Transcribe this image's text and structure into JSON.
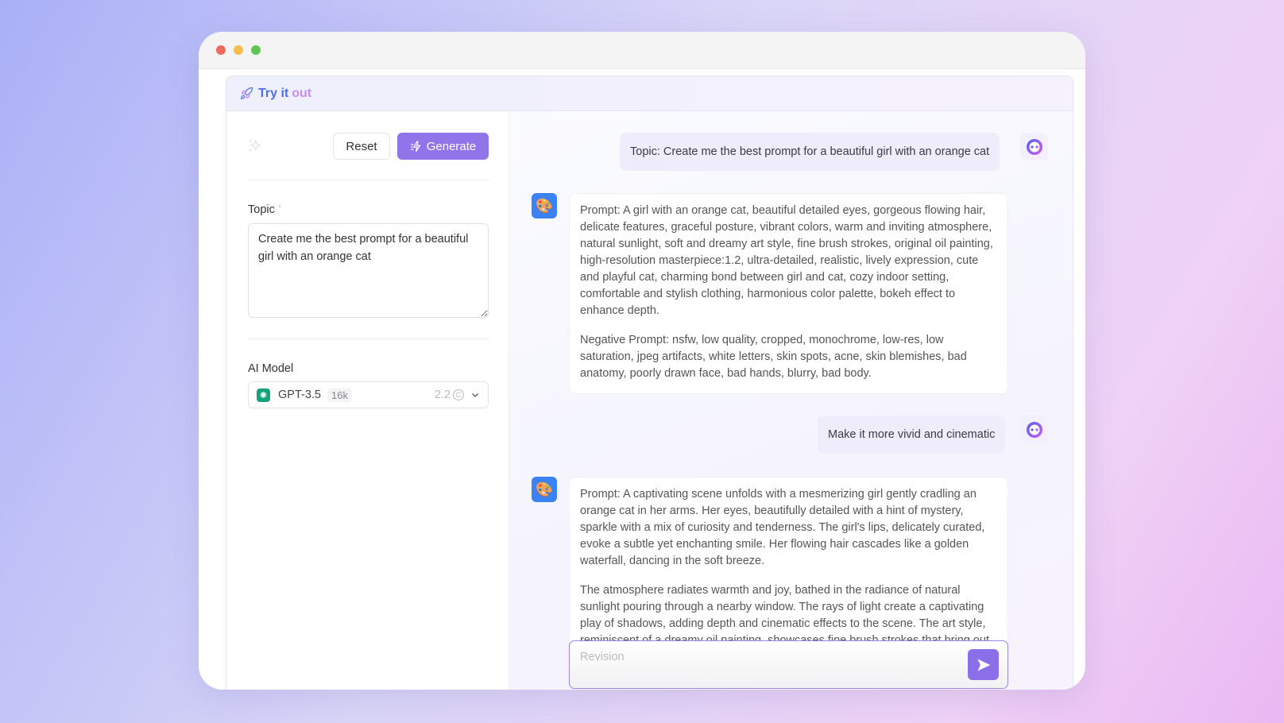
{
  "window": {
    "dots": [
      "#ee6a5e",
      "#f5be4f",
      "#61c554"
    ]
  },
  "header": {
    "title_part1": "Try it",
    "title_part2": "out",
    "icon": "rocket-icon"
  },
  "form": {
    "reset_label": "Reset",
    "generate_label": "Generate",
    "topic_label": "Topic",
    "required_mark": "*",
    "topic_value": "Create me the best prompt for a beautiful girl with an orange cat",
    "model_label": "AI Model",
    "model": {
      "name": "GPT-3.5",
      "context": "16k",
      "cost": "2.2"
    }
  },
  "chat": {
    "messages": [
      {
        "role": "user",
        "text": "Topic: Create me the best prompt for a beautiful girl with an orange cat"
      },
      {
        "role": "bot",
        "paragraphs": [
          "Prompt: A girl with an orange cat, beautiful detailed eyes, gorgeous flowing hair, delicate features, graceful posture, vibrant colors, warm and inviting atmosphere, natural sunlight, soft and dreamy art style, fine brush strokes, original oil painting, high-resolution masterpiece:1.2, ultra-detailed, realistic, lively expression, cute and playful cat, charming bond between girl and cat, cozy indoor setting, comfortable and stylish clothing, harmonious color palette, bokeh effect to enhance depth.",
          "Negative Prompt: nsfw, low quality, cropped, monochrome, low-res, low saturation, jpeg artifacts, white letters, skin spots, acne, skin blemishes, bad anatomy, poorly drawn face, bad hands, blurry, bad body."
        ]
      },
      {
        "role": "user",
        "text": "Make it more vivid and cinematic"
      },
      {
        "role": "bot",
        "paragraphs": [
          "Prompt: A captivating scene unfolds with a mesmerizing girl gently cradling an orange cat in her arms. Her eyes, beautifully detailed with a hint of mystery, sparkle with a mix of curiosity and tenderness. The girl's lips, delicately curated, evoke a subtle yet enchanting smile. Her flowing hair cascades like a golden waterfall, dancing in the soft breeze.",
          "The atmosphere radiates warmth and joy, bathed in the radiance of natural sunlight pouring through a nearby window. The rays of light create a captivating play of shadows, adding depth and cinematic effects to the scene. The art style, reminiscent of a dreamy oil painting, showcases fine brush strokes that bring out"
        ]
      }
    ],
    "input_placeholder": "Revision"
  },
  "colors": {
    "accent": "#8b6fe8",
    "title_blue": "#4f6ef0",
    "title_purple": "#c98cf0"
  }
}
